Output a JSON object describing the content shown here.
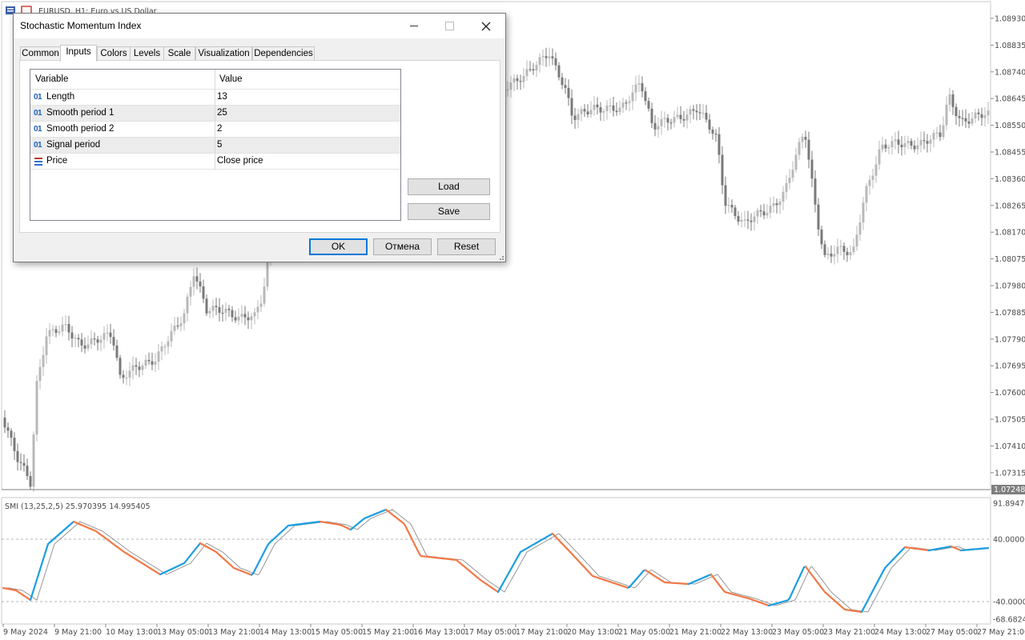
{
  "chart": {
    "window_title": "EURUSD, H1:  Euro vs US Dollar",
    "current_price": "1.07248",
    "price_ticks": [
      "1.08930",
      "1.08835",
      "1.08740",
      "1.08645",
      "1.08550",
      "1.08455",
      "1.08360",
      "1.08265",
      "1.08170",
      "1.08075",
      "1.07980",
      "1.07885",
      "1.07790",
      "1.07695",
      "1.07600",
      "1.07505",
      "1.07410",
      "1.07315"
    ],
    "indicator_label": "SMI (13,25,2,5) 25.970395 14.995405",
    "indicator_ticks": [
      "91.89470",
      "40.00000",
      "-40.00000",
      "-68.68244"
    ],
    "time_labels": [
      "9 May 2024",
      "9 May 21:00",
      "10 May 13:00",
      "13 May 05:00",
      "13 May 21:00",
      "14 May 13:00",
      "15 May 05:00",
      "15 May 21:00",
      "16 May 13:00",
      "17 May 05:00",
      "17 May 21:00",
      "20 May 13:00",
      "21 May 05:00",
      "21 May 21:00",
      "22 May 13:00",
      "23 May 05:00",
      "23 May 21:00",
      "24 May 13:00",
      "27 May 05:00",
      "27 May 21:00"
    ],
    "colors": {
      "smi_up": "#1e9fe0",
      "smi_down": "#f07b4a",
      "signal": "#8c8c8c",
      "candles": "#9a9a9a"
    }
  },
  "dialog": {
    "title": "Stochastic Momentum Index",
    "tabs": [
      "Common",
      "Inputs",
      "Colors",
      "Levels",
      "Scale",
      "Visualization",
      "Dependencies"
    ],
    "active_tab": "Inputs",
    "grid": {
      "headers": [
        "Variable",
        "Value"
      ],
      "rows": [
        {
          "icon": "01",
          "name": "Length",
          "value": "13"
        },
        {
          "icon": "01",
          "name": "Smooth period 1",
          "value": "25"
        },
        {
          "icon": "01",
          "name": "Smooth period 2",
          "value": "2"
        },
        {
          "icon": "01",
          "name": "Signal period",
          "value": "5"
        },
        {
          "icon": "enum-list-icon",
          "name": "Price",
          "value": "Close price"
        }
      ]
    },
    "buttons": {
      "load": "Load",
      "save": "Save",
      "ok": "OK",
      "cancel": "Отмена",
      "reset": "Reset"
    }
  }
}
